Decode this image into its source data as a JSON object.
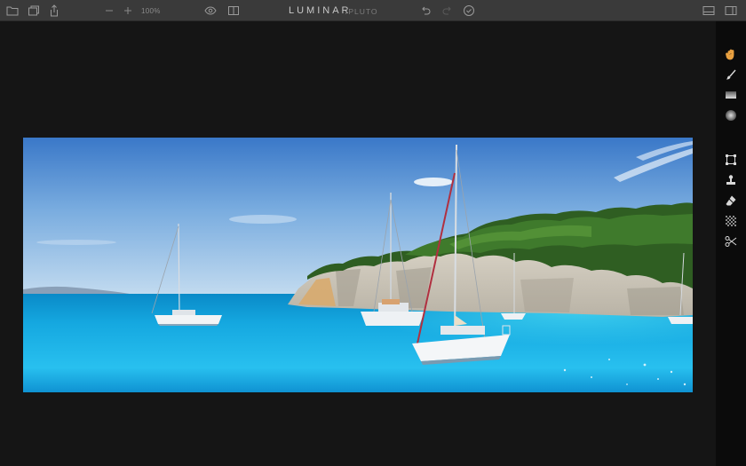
{
  "app": {
    "title": "LUMINAR",
    "subtitle": "/PLUTO"
  },
  "toolbar": {
    "zoom_level": "100%",
    "left_icons": [
      "folder-icon",
      "layers-icon",
      "share-icon"
    ],
    "zoom_icons": [
      "zoom-out-icon",
      "zoom-in-icon"
    ],
    "view_icons": [
      "eye-preview-icon",
      "compare-split-icon"
    ],
    "history_icons": [
      "undo-icon",
      "redo-icon",
      "history-check-icon"
    ],
    "right_icons": [
      "layout-panel-icon",
      "layout-filmstrip-icon"
    ]
  },
  "right_tools": [
    "hand-icon",
    "brush-icon",
    "gradient-icon",
    "radial-mask-icon",
    "crop-icon",
    "stamp-icon",
    "eraser-icon",
    "noise-icon",
    "scissors-icon"
  ],
  "colors": {
    "toolbar_bg": "#3a3a3a",
    "canvas_bg": "#151515",
    "panel_bg": "#0b0b0b",
    "accent_active": "#e8a040"
  }
}
